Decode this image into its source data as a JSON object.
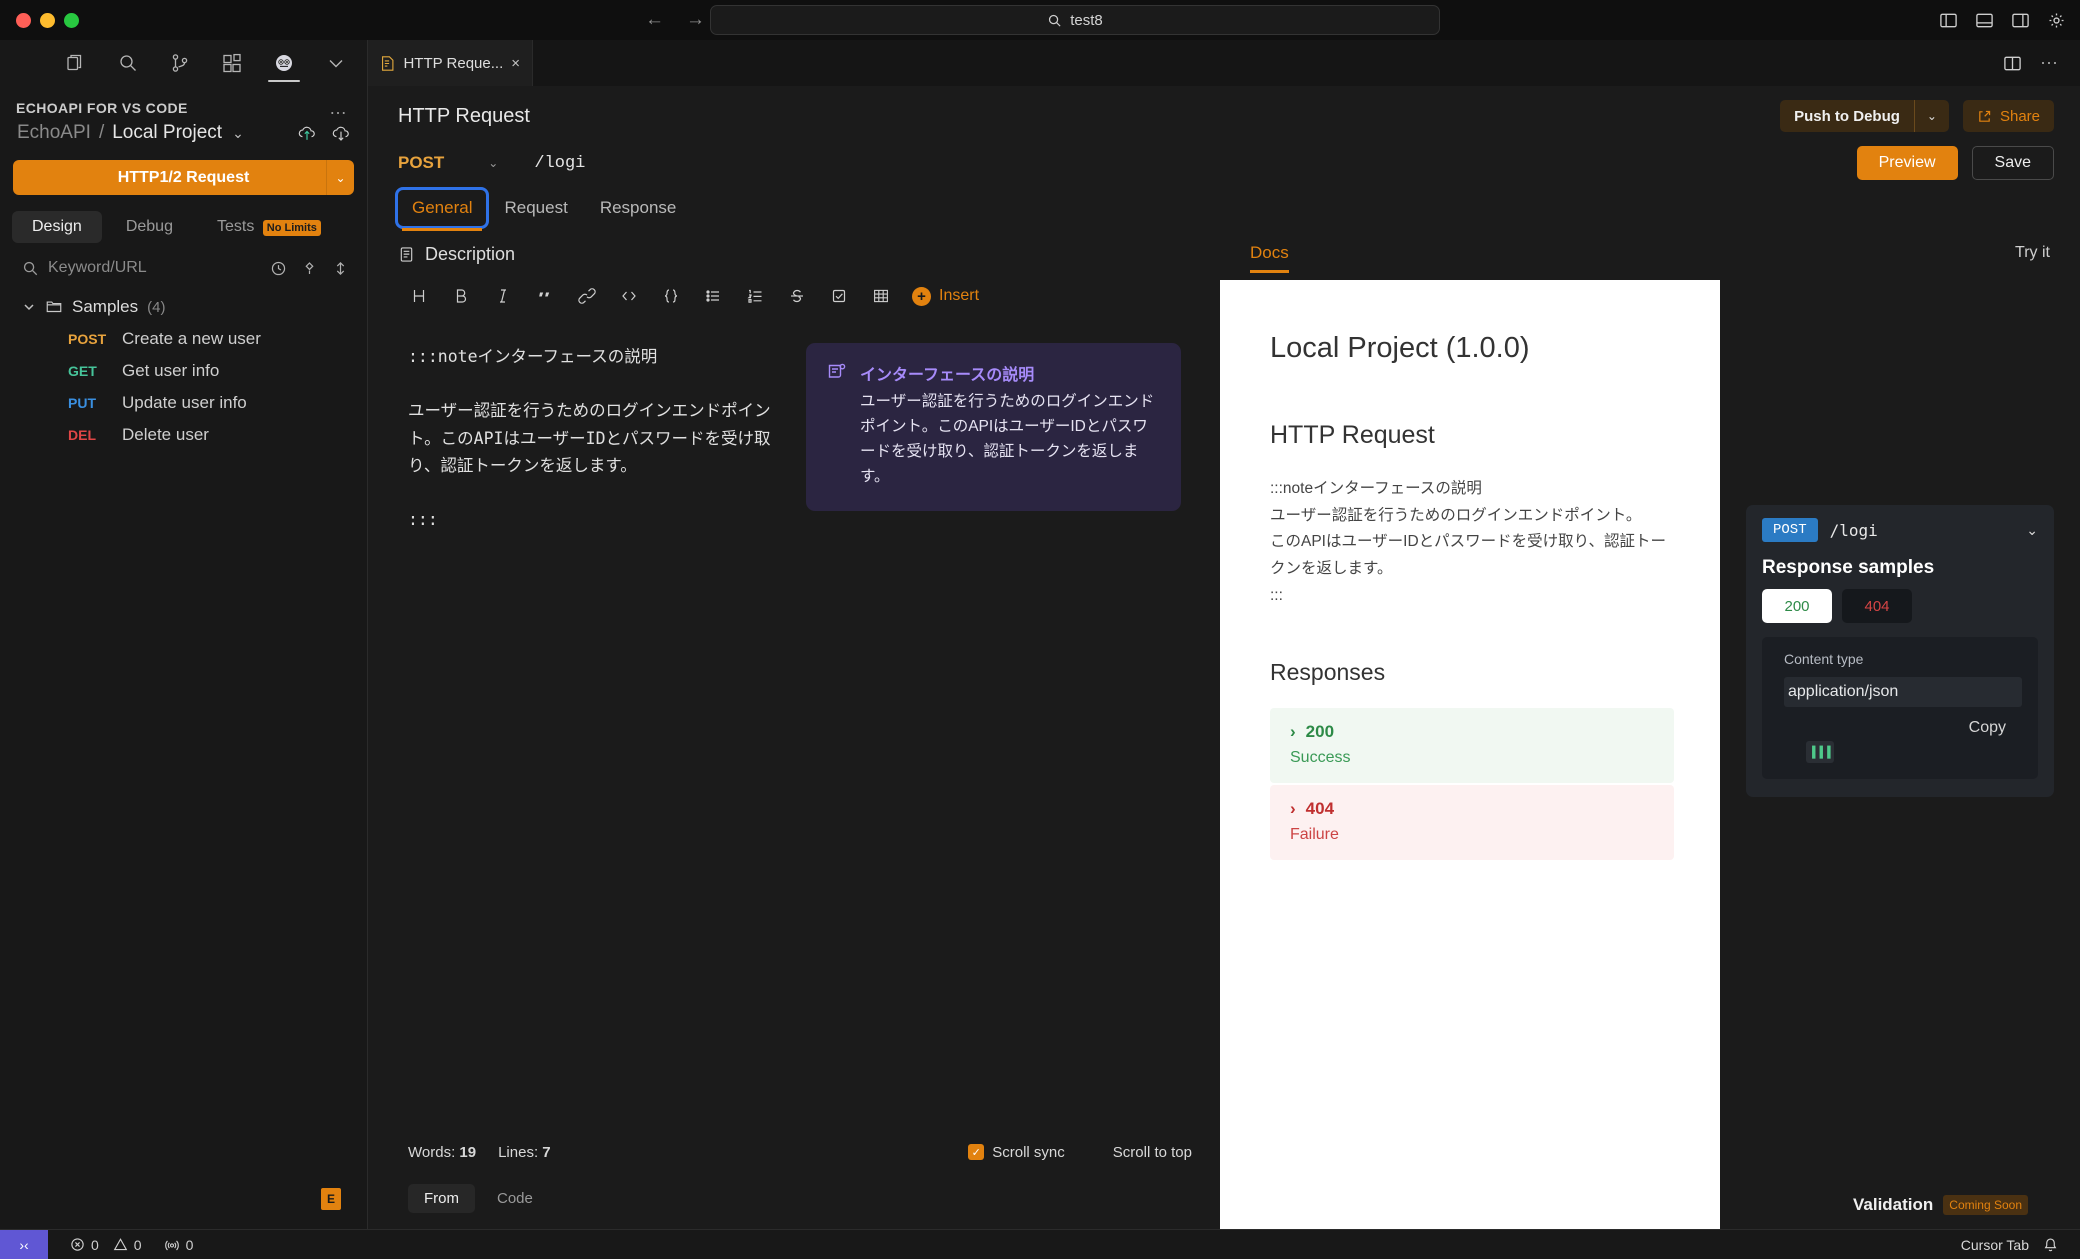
{
  "window": {
    "traffic_lights": [
      "close",
      "minimize",
      "maximize"
    ],
    "omnibox_value": "test8",
    "omnibox_icon": "search-icon",
    "nav_back": "←",
    "nav_forward": "→"
  },
  "activity_bar": {
    "items": [
      {
        "name": "explorer-icon",
        "label": "Explorer"
      },
      {
        "name": "search-icon",
        "label": "Search"
      },
      {
        "name": "source-control-icon",
        "label": "Source Control"
      },
      {
        "name": "extensions-icon",
        "label": "Extensions"
      },
      {
        "name": "echoapi-icon",
        "label": "EchoAPI",
        "active": true
      },
      {
        "name": "chevron-down-icon",
        "label": "More"
      }
    ]
  },
  "sidebar": {
    "title": "ECHOAPI FOR VS CODE",
    "more_actions": "…",
    "project": {
      "org": "EchoAPI",
      "separator": "/",
      "name": "Local Project",
      "caret": "⌄",
      "upload_icon": "cloud-upload-icon",
      "download_icon": "cloud-download-icon"
    },
    "new_request_button": "HTTP1/2 Request",
    "new_request_caret": "⌄",
    "tabs": [
      {
        "label": "Design",
        "active": true
      },
      {
        "label": "Debug",
        "active": false
      },
      {
        "label": "Tests",
        "active": false,
        "badge": "No Limits"
      }
    ],
    "search_placeholder": "Keyword/URL",
    "tree": {
      "folder": {
        "label": "Samples",
        "count": "(4)",
        "chevron": "⌄"
      },
      "items": [
        {
          "method": "POST",
          "method_class": "m-post",
          "name": "Create a new user"
        },
        {
          "method": "GET",
          "method_class": "m-get",
          "name": "Get user info"
        },
        {
          "method": "PUT",
          "method_class": "m-put",
          "name": "Update user info"
        },
        {
          "method": "DEL",
          "method_class": "m-del",
          "name": "Delete user"
        }
      ]
    },
    "bottom_badge": "E"
  },
  "editor": {
    "tab": {
      "title": "HTTP Reque...",
      "close": "×",
      "icon": "api-file-icon"
    },
    "tab_actions": {
      "split_icon": "split-editor-icon",
      "more_icon": "more-actions-icon"
    },
    "request": {
      "title": "HTTP Request",
      "push_to_debug": "Push to Debug",
      "push_caret": "⌄",
      "share": "Share",
      "method": "POST",
      "method_caret": "⌄",
      "path": "/logi",
      "preview": "Preview",
      "save": "Save"
    },
    "subtabs": [
      {
        "label": "General",
        "active": true,
        "focused": true
      },
      {
        "label": "Request",
        "active": false
      },
      {
        "label": "Response",
        "active": false
      }
    ],
    "description": {
      "heading": "Description",
      "heading_icon": "document-icon",
      "toolbar": [
        {
          "name": "heading-icon",
          "glyph": "H"
        },
        {
          "name": "bold-icon",
          "glyph": "B"
        },
        {
          "name": "italic-icon",
          "glyph": "I"
        },
        {
          "name": "quote-icon",
          "glyph": "“"
        },
        {
          "name": "link-icon",
          "glyph": "🔗"
        },
        {
          "name": "code-icon",
          "glyph": "</>"
        },
        {
          "name": "code-block-icon",
          "glyph": "{ }"
        },
        {
          "name": "bullet-list-icon",
          "glyph": "≡"
        },
        {
          "name": "ordered-list-icon",
          "glyph": "≡"
        },
        {
          "name": "strikethrough-icon",
          "glyph": "S"
        },
        {
          "name": "checklist-icon",
          "glyph": "☑"
        },
        {
          "name": "table-icon",
          "glyph": "▦"
        }
      ],
      "insert_label": "Insert",
      "insert_plus": "+",
      "markdown": ":::noteインターフェースの説明\n\nユーザー認証を行うためのログインエンドポイント。このAPIはユーザーIDとパスワードを受け取り、認証トークンを返します。\n\n:::",
      "note_card": {
        "icon": "note-icon",
        "title": "インターフェースの説明",
        "text": "ユーザー認証を行うためのログインエンドポイント。このAPIはユーザーIDとパスワードを受け取り、認証トークンを返します。"
      }
    },
    "footer": {
      "words_label": "Words:",
      "words_value": "19",
      "lines_label": "Lines:",
      "lines_value": "7",
      "scroll_sync": "Scroll sync",
      "scroll_sync_checked": "✓",
      "scroll_to_top": "Scroll to top",
      "mode_tabs": [
        {
          "label": "From",
          "active": true
        },
        {
          "label": "Code",
          "active": false
        }
      ]
    }
  },
  "docs": {
    "tab": "Docs",
    "try_it": "Try it",
    "title": "Local Project (1.0.0)",
    "section_title": "HTTP Request",
    "body": ":::noteインターフェースの説明\nユーザー認証を行うためのログインエンドポイント。\nこのAPIはユーザーIDとパスワードを受け取り、認証トークンを返します。\n:::",
    "responses_heading": "Responses",
    "responses": [
      {
        "code": "200",
        "desc": "Success",
        "chevron": "›",
        "state": "ok"
      },
      {
        "code": "404",
        "desc": "Failure",
        "chevron": "›",
        "state": "err"
      }
    ],
    "sample_panel": {
      "method": "POST",
      "path": "/logi",
      "caret": "⌄",
      "title": "Response samples",
      "code_tabs": [
        {
          "label": "200",
          "selected": true
        },
        {
          "label": "404",
          "selected": false
        }
      ],
      "content_type_label": "Content type",
      "content_type_value": "application/json",
      "copy_label": "Copy",
      "code_chip": "▐▐▐"
    },
    "validation_label": "Validation",
    "validation_badge": "Coming Soon"
  },
  "statusbar": {
    "remote_icon": "remote-window-icon",
    "errors_icon": "error-icon",
    "errors_count": "0",
    "warnings_icon": "warning-icon",
    "warnings_count": "0",
    "ports_icon": "ports-icon",
    "ports_count": "0",
    "cursor_tab": "Cursor Tab",
    "bell_icon": "bell-icon"
  },
  "colors": {
    "accent": "#e2820f",
    "focus_ring": "#2f72e8",
    "note_purple": "#a78bfa",
    "success": "#2d8a47",
    "error": "#c03030",
    "post": "#e8a33d",
    "get": "#46c49a",
    "put": "#3a8fe0",
    "del": "#e04646"
  }
}
